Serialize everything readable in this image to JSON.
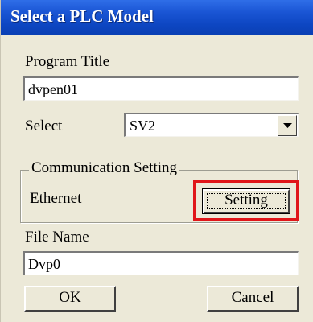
{
  "window": {
    "title": "Select a PLC Model"
  },
  "program_title": {
    "label": "Program Title",
    "value": "dvpen01"
  },
  "select": {
    "label": "Select",
    "value": "SV2"
  },
  "communication": {
    "legend": "Communication Setting",
    "interface": "Ethernet",
    "setting_button": "Setting"
  },
  "file_name": {
    "label": "File Name",
    "value": "Dvp0"
  },
  "buttons": {
    "ok": "OK",
    "cancel": "Cancel"
  },
  "colors": {
    "titlebar": "#1a55d4",
    "dialog_bg": "#ece9d8",
    "highlight": "#e0161a"
  },
  "icons": {
    "dropdown": "chevron-down-icon"
  }
}
